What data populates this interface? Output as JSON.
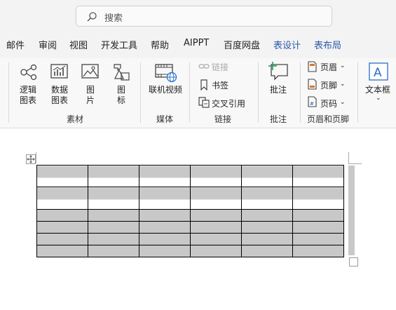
{
  "search": {
    "placeholder": "搜索"
  },
  "menu_tabs": [
    "邮件",
    "审阅",
    "视图",
    "开发工具",
    "帮助",
    "AIPPT",
    "百度网盘",
    "表设计",
    "表布局"
  ],
  "ribbon": {
    "materials": {
      "items": [
        {
          "line1": "逻辑",
          "line2": "图表",
          "icon": "logic-chart-icon"
        },
        {
          "line1": "数据",
          "line2": "图表",
          "icon": "data-chart-icon"
        },
        {
          "line1": "图",
          "line2": "片",
          "icon": "picture-icon"
        },
        {
          "line1": "图",
          "line2": "标",
          "icon": "shapes-icon"
        }
      ],
      "group_label": "素材"
    },
    "media": {
      "button_label": "联机视频",
      "icon": "online-video-icon",
      "group_label": "媒体"
    },
    "links": {
      "link_label": "链接",
      "bookmark_label": "书签",
      "crossref_label": "交叉引用",
      "group_label": "链接"
    },
    "comments": {
      "button_label": "批注",
      "icon": "comment-icon",
      "group_label": "批注"
    },
    "header_footer": {
      "header_label": "页眉",
      "footer_label": "页脚",
      "page_number_label": "页码",
      "group_label": "页眉和页脚"
    },
    "text": {
      "textbox_label": "文本框",
      "icon": "textbox-icon"
    }
  },
  "colors": {
    "accent_blue": "#2a58a8",
    "table_fill": "#c8c8c8"
  }
}
